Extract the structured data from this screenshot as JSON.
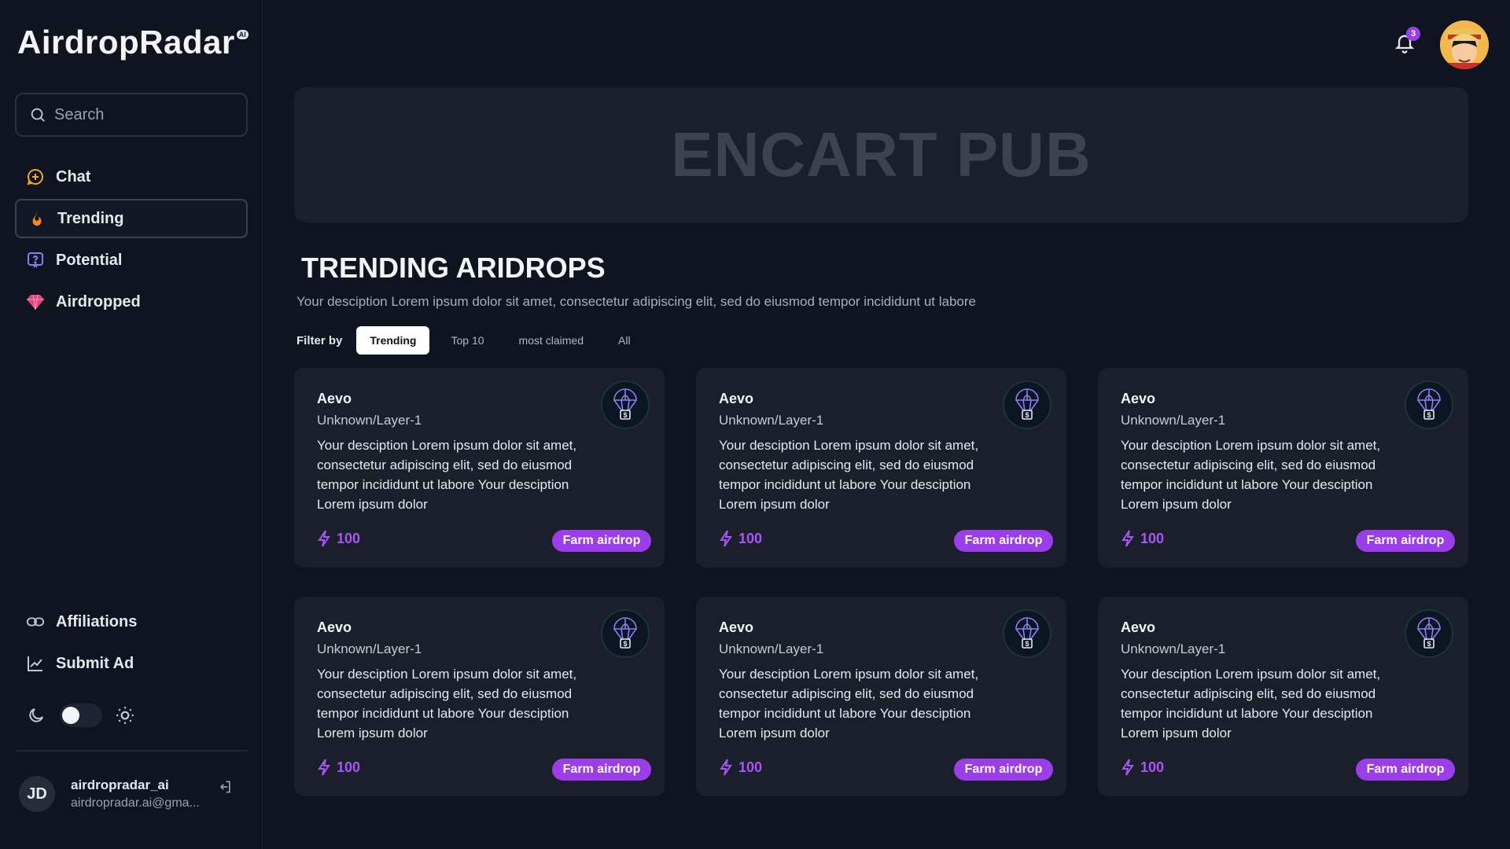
{
  "brand": {
    "name": "AirdropRadar",
    "badge": "AI"
  },
  "search": {
    "placeholder": "Search"
  },
  "nav": {
    "items": [
      {
        "label": "Chat",
        "icon": "chat-plus-icon"
      },
      {
        "label": "Trending",
        "icon": "flame-icon",
        "active": true
      },
      {
        "label": "Potential",
        "icon": "question-chat-icon"
      },
      {
        "label": "Airdropped",
        "icon": "gem-icon"
      }
    ],
    "bottom": [
      {
        "label": "Affiliations",
        "icon": "link-icon"
      },
      {
        "label": "Submit Ad",
        "icon": "chart-line-icon"
      }
    ]
  },
  "user": {
    "initials": "JD",
    "name": "airdropradar_ai",
    "email": "airdropradar.ai@gma..."
  },
  "notifications": {
    "count": "3"
  },
  "banner": {
    "text": "ENCART PUB"
  },
  "section": {
    "title": "TRENDING ARIDROPS",
    "description": "Your desciption Lorem ipsum dolor sit amet, consectetur adipiscing elit, sed do eiusmod tempor incididunt ut labore"
  },
  "filters": {
    "label": "Filter by",
    "options": [
      "Trending",
      "Top 10",
      "most claimed",
      "All"
    ],
    "selected": "Trending"
  },
  "cards": [
    {
      "title": "Aevo",
      "subtitle": "Unknown/Layer-1",
      "description": "Your desciption Lorem ipsum dolor sit amet, consectetur adipiscing elit, sed do eiusmod tempor incididunt ut labore Your desciption Lorem ipsum dolor",
      "points": "100",
      "button": "Farm airdrop"
    },
    {
      "title": "Aevo",
      "subtitle": "Unknown/Layer-1",
      "description": "Your desciption Lorem ipsum dolor sit amet, consectetur adipiscing elit, sed do eiusmod tempor incididunt ut labore Your desciption Lorem ipsum dolor",
      "points": "100",
      "button": "Farm airdrop"
    },
    {
      "title": "Aevo",
      "subtitle": "Unknown/Layer-1",
      "description": "Your desciption Lorem ipsum dolor sit amet, consectetur adipiscing elit, sed do eiusmod tempor incididunt ut labore Your desciption Lorem ipsum dolor",
      "points": "100",
      "button": "Farm airdrop"
    },
    {
      "title": "Aevo",
      "subtitle": "Unknown/Layer-1",
      "description": "Your desciption Lorem ipsum dolor sit amet, consectetur adipiscing elit, sed do eiusmod tempor incididunt ut labore Your desciption Lorem ipsum dolor",
      "points": "100",
      "button": "Farm airdrop"
    },
    {
      "title": "Aevo",
      "subtitle": "Unknown/Layer-1",
      "description": "Your desciption Lorem ipsum dolor sit amet, consectetur adipiscing elit, sed do eiusmod tempor incididunt ut labore Your desciption Lorem ipsum dolor",
      "points": "100",
      "button": "Farm airdrop"
    },
    {
      "title": "Aevo",
      "subtitle": "Unknown/Layer-1",
      "description": "Your desciption Lorem ipsum dolor sit amet, consectetur adipiscing elit, sed do eiusmod tempor incididunt ut labore Your desciption Lorem ipsum dolor",
      "points": "100",
      "button": "Farm airdrop"
    }
  ],
  "colors": {
    "accent": "#9b3de8",
    "background": "#0f1420",
    "card": "#1a1f2b"
  },
  "theme": {
    "mode": "dark",
    "icons": [
      "moon-icon",
      "sun-icon"
    ]
  }
}
